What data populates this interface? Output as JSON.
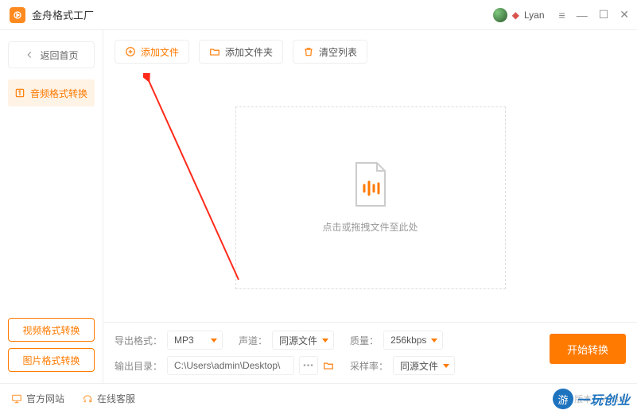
{
  "app": {
    "title": "金舟格式工厂"
  },
  "user": {
    "name": "Lyan"
  },
  "sidebar": {
    "back_label": "返回首页",
    "active_tab": "音频格式转换",
    "links": [
      "视频格式转换",
      "图片格式转换"
    ]
  },
  "toolbar": {
    "add_file": "添加文件",
    "add_folder": "添加文件夹",
    "clear_list": "清空列表"
  },
  "drop": {
    "hint": "点击或拖拽文件至此处"
  },
  "settings": {
    "export_format_label": "导出格式：",
    "export_format_value": "MP3",
    "channel_label": "声道：",
    "channel_value": "同源文件",
    "quality_label": "质量：",
    "quality_value": "256kbps",
    "output_dir_label": "输出目录：",
    "output_dir_value": "C:\\Users\\admin\\Desktop\\",
    "sample_rate_label": "采样率：",
    "sample_rate_value": "同源文件",
    "convert_button": "开始转换"
  },
  "footer": {
    "official_site": "官方网站",
    "online_support": "在线客服",
    "version": "版本：V2.3.3"
  },
  "watermark": {
    "badge": "游",
    "text": "一玩创业"
  }
}
